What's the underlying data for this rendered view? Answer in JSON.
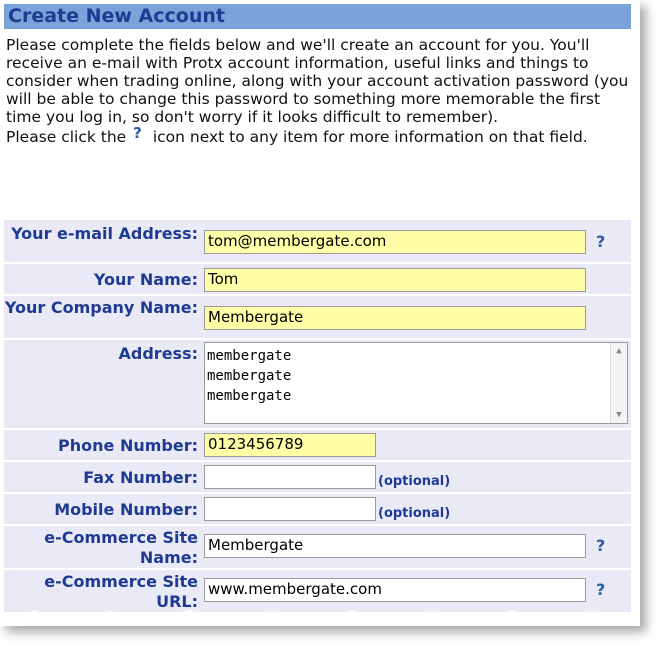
{
  "header": {
    "title": "Create New Account"
  },
  "intro": {
    "paragraph1": "Please complete the fields below and we'll create an account for you. You'll receive an e-mail with Protx account information, useful links and things to consider when trading online, along with your account activation password (you will be able to change this password to something more memorable the first time you log in, so don't worry if it looks difficult to remember).",
    "paragraph2_before": "Please click the",
    "help_icon": "?",
    "paragraph2_after": "icon next to any item for more information on that field."
  },
  "form": {
    "email": {
      "label": "Your e-mail Address:",
      "value": "tom@membergate.com"
    },
    "name": {
      "label": "Your Name:",
      "value": "Tom"
    },
    "company": {
      "label": "Your Company Name:",
      "value": "Membergate"
    },
    "address": {
      "label": "Address:",
      "lines": [
        "membergate",
        "membergate",
        "membergate"
      ]
    },
    "phone": {
      "label": "Phone Number:",
      "value": "0123456789"
    },
    "fax": {
      "label": "Fax Number:",
      "value": "",
      "optional": "(optional)"
    },
    "mobile": {
      "label": "Mobile Number:",
      "value": "",
      "optional": "(optional)"
    },
    "site_name": {
      "label": "e-Commerce Site Name:",
      "value": "Membergate"
    },
    "site_url": {
      "label": "e-Commerce Site URL:",
      "value": "www.membergate.com"
    },
    "help_symbol": "?"
  },
  "colors": {
    "header_bg": "#7AA4D9",
    "title": "#1F3A93",
    "required_field": "#FFFFA8",
    "row_bg": "#EAEAF6"
  }
}
